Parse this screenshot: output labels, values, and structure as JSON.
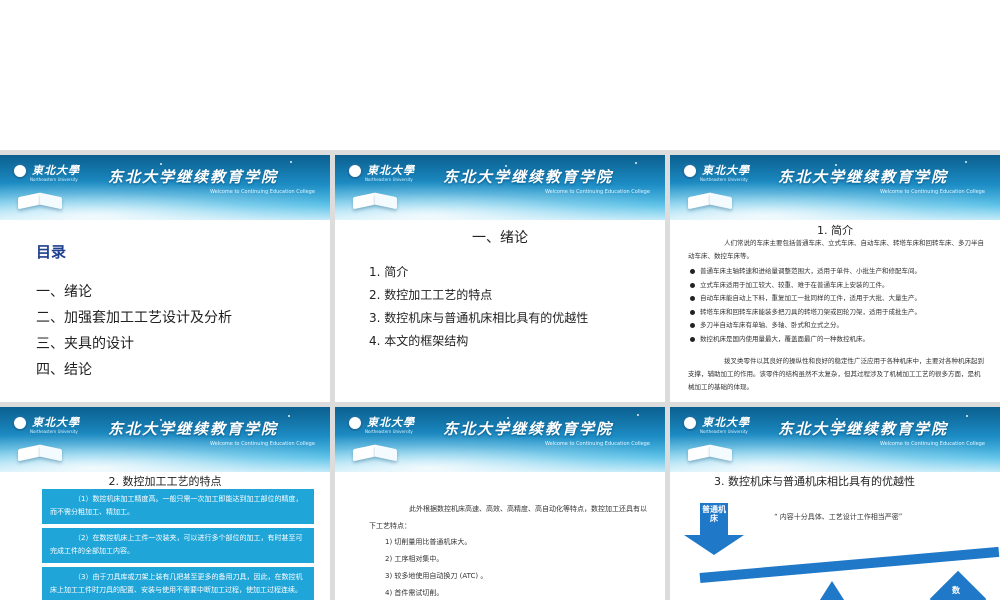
{
  "banner": {
    "logo_text": "東北大學",
    "logo_sub": "Northeastern University",
    "title": "东北大学继续教育学院",
    "subtitle": "Welcome to Continuing Education College"
  },
  "slide1": {
    "heading": "目录",
    "items": [
      "一、绪论",
      "二、加强套加工工艺设计及分析",
      "三、夹具的设计",
      "四、结论"
    ]
  },
  "slide2": {
    "heading": "一、绪论",
    "items": [
      "1. 简介",
      "2. 数控加工工艺的特点",
      "3. 数控机床与普通机床相比具有的优越性",
      "4. 本文的框架结构"
    ]
  },
  "slide3": {
    "heading": "1. 简介",
    "intro": "人们常说的车床主要包括普通车床、立式车床、自动车床、转塔车床和回转车床、多刀半自动车床、数控车床等。",
    "bullets": [
      "普通车床主轴转速和进给量调整范围大，适用于单件、小批生产和修配车间。",
      "立式车床适用于加工较大、较重、难于在普通车床上安装的工件。",
      "自动车床能自动上下料，重复加工一批同样的工件，适用于大批、大量生产。",
      "转塔车床和回转车床能装多把刀具的转塔刀架或回轮刀架，适用于成批生产。",
      "多刀半自动车床有单轴、多轴、卧式和立式之分。",
      "数控机床是国内使用量最大，覆盖面最广的一种数控机床。"
    ],
    "closing": "拨叉类零件以其良好的操纵性和良好的稳定性广泛应用于各种机床中，主要对各种机床起到支撑，辅助加工的作用。该零件的结构虽然不太复杂，但其过程涉及了机械加工工艺的很多方面，是机械加工的基础的体现。"
  },
  "slide4": {
    "heading": "2. 数控加工工艺的特点",
    "boxes": [
      "（1）数控机床加工精度高。一般只需一次加工即能达到加工部位的精度，而不需分粗加工、精加工。",
      "（2）在数控机床上工件一次装夹，可以进行多个部位的加工，有时甚至可完成工件的全部加工内容。",
      "（3）由于刀具库或刀架上装有几把甚至更多的备用刀具，因此，在数控机床上加工工件时刀具的配置、安装与使用不需要中断加工过程，使加工过程连续。"
    ]
  },
  "slide5": {
    "intro": "此外根据数控机床高速、高效、高精度、高自动化等特点，数控加工还具有以下工艺特点：",
    "items": [
      "1) 切削量用比普通机床大。",
      "2) 工序相对集中。",
      "3) 较多地使用自动换刀 (ATC) 。",
      "4) 首件需试切削。"
    ]
  },
  "slide6": {
    "heading": "3. 数控机床与普通机床相比具有的优越性",
    "arrow_label": "普通机床",
    "quote": "“ 内容十分具体、工艺设计工作相当严密”",
    "diamond_label": "数"
  }
}
